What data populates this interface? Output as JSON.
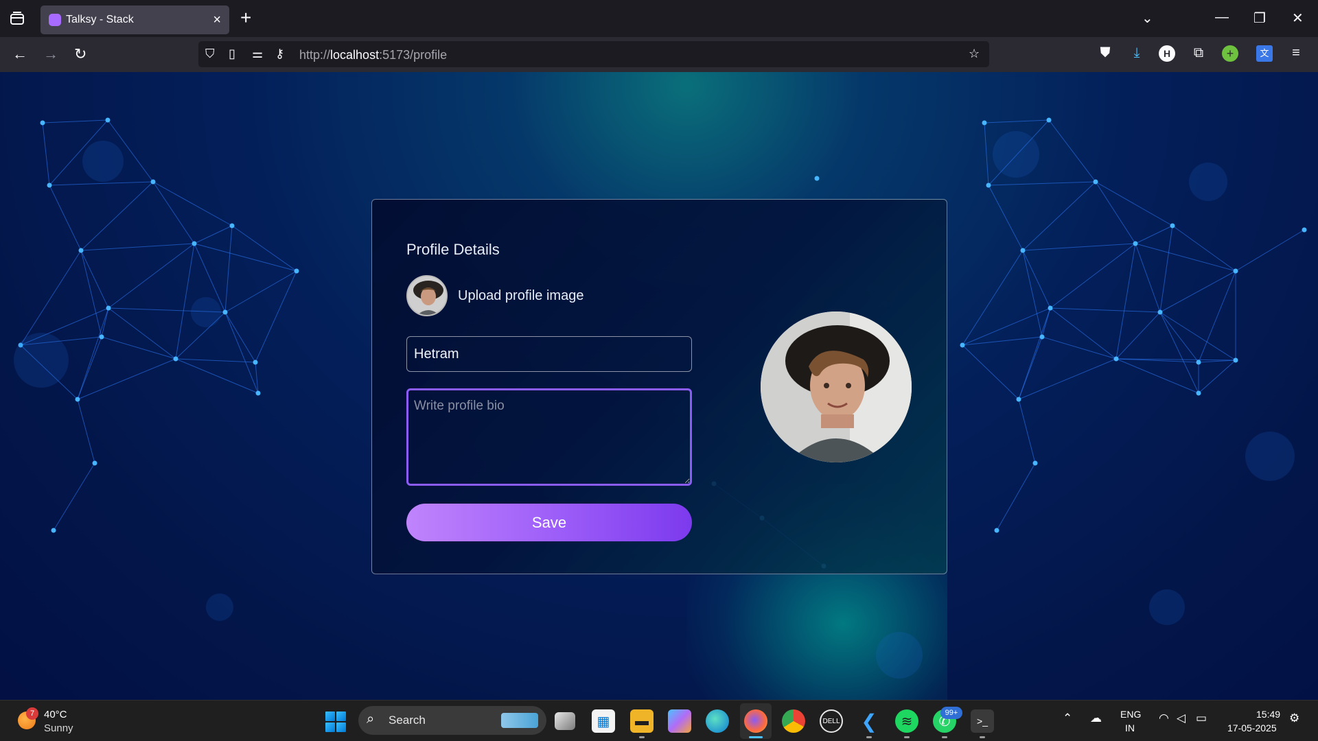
{
  "browser": {
    "tab_title": "Talksy - Stack",
    "url_prefix": "http://",
    "url_host": "localhost",
    "url_path": ":5173/profile"
  },
  "profile": {
    "heading": "Profile Details",
    "upload_label": "Upload profile image",
    "name_value": "Hetram",
    "bio_placeholder": "Write profile bio",
    "save_label": "Save"
  },
  "taskbar": {
    "weather_badge": "7",
    "weather_temp": "40°C",
    "weather_condition": "Sunny",
    "search_label": "Search",
    "whatsapp_badge": "99+",
    "lang_line1": "ENG",
    "lang_line2": "IN",
    "time": "15:49",
    "date": "17-05-2025"
  },
  "colors": {
    "accent_purple": "#8b5cf6",
    "button_gradient_start": "#c084fc",
    "button_gradient_end": "#7c3aed",
    "page_background": "#031f5a"
  }
}
